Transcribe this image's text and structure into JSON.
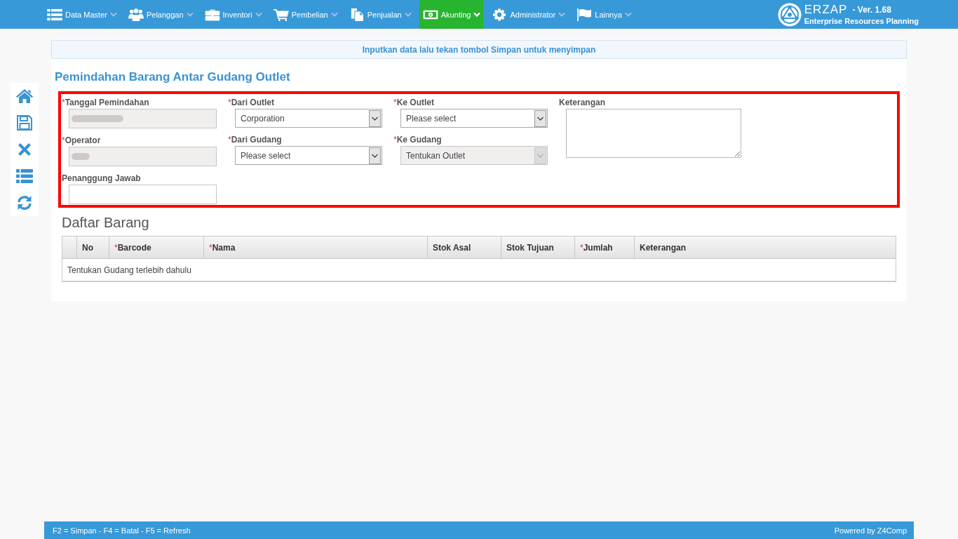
{
  "nav": {
    "items": [
      {
        "label": "Data Master",
        "selected": false
      },
      {
        "label": "Pelanggan",
        "selected": false
      },
      {
        "label": "Inventori",
        "selected": false
      },
      {
        "label": "Pembelian",
        "selected": false
      },
      {
        "label": "Penjualan",
        "selected": false
      },
      {
        "label": "Akunting",
        "selected": true
      },
      {
        "label": "Administrator",
        "selected": false
      },
      {
        "label": "Lainnya",
        "selected": false
      }
    ],
    "brand": {
      "name": "ERZAP",
      "version": "- Ver. 1.68",
      "tagline": "Enterprise Resources Planning"
    }
  },
  "notice": "Inputkan data lalu tekan tombol Simpan untuk menyimpan",
  "page_title": "Pemindahan Barang Antar Gudang Outlet",
  "form": {
    "highlighted": true,
    "columns": [
      [
        {
          "kind": "text",
          "mark": "*",
          "label": "Tanggal Pemindahan",
          "disabled": true,
          "obscured": true
        },
        {
          "kind": "text",
          "mark": "*",
          "label": "Operator",
          "disabled": true,
          "obscured": true
        },
        {
          "kind": "text",
          "label": "Penanggung Jawab",
          "disabled": false
        }
      ],
      [
        {
          "kind": "select",
          "mark": "*",
          "label": "Dari Outlet",
          "value": "Corporation",
          "disabled": false
        },
        {
          "kind": "select",
          "mark": "*",
          "label": "Dari Gudang",
          "value": "Please select",
          "disabled": false
        }
      ],
      [
        {
          "kind": "select",
          "mark": "*",
          "label": "Ke Outlet",
          "value": "Please select",
          "disabled": false
        },
        {
          "kind": "select",
          "mark": "*",
          "label": "Ke Gudang",
          "value": "Tentukan Outlet",
          "disabled": true
        }
      ],
      [
        {
          "kind": "textarea",
          "label": "Keterangan",
          "disabled": false
        }
      ]
    ]
  },
  "items_table": {
    "title": "Daftar Barang",
    "columns": [
      {
        "label": "No"
      },
      {
        "mark": "*",
        "label": "Barcode"
      },
      {
        "mark": "*",
        "label": "Nama"
      },
      {
        "label": "Stok Asal"
      },
      {
        "label": "Stok Tujuan"
      },
      {
        "mark": "*",
        "label": "Jumlah"
      },
      {
        "label": "Keterangan"
      }
    ],
    "empty_message": "Tentukan Gudang terlebih dahulu"
  },
  "footer": {
    "shortcuts": "F2 = Simpan - F4 = Batal - F5 = Refresh",
    "credit": "Powered by Z4Comp"
  }
}
